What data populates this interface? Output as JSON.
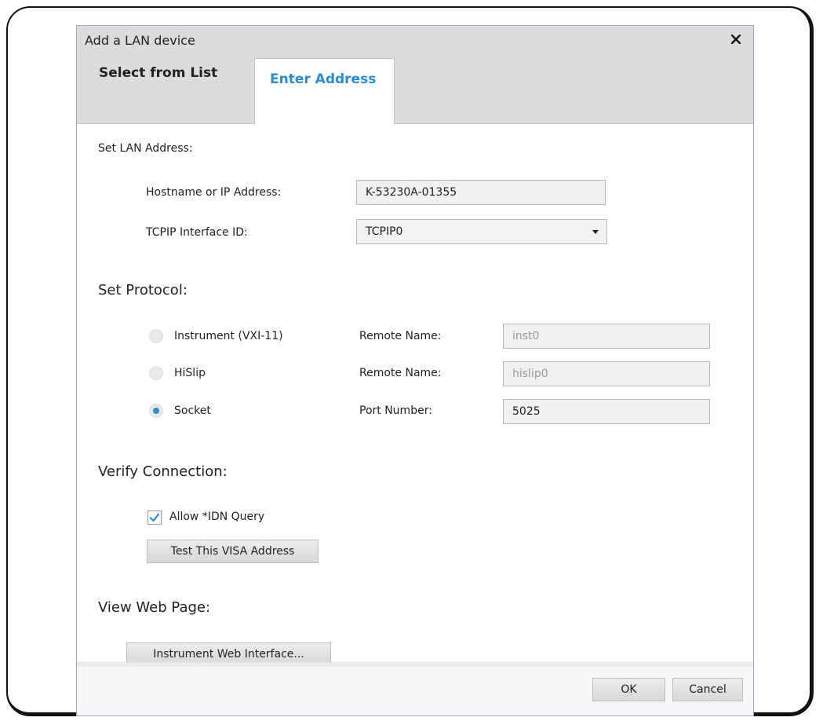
{
  "dialog": {
    "title": "Add a LAN device",
    "close_icon": "✕"
  },
  "tabs": [
    {
      "label": "Select from List",
      "active": false
    },
    {
      "label": "Enter Address",
      "active": true
    }
  ],
  "lan_address": {
    "heading": "Set LAN Address:",
    "hostname_label": "Hostname or IP Address:",
    "hostname_value": "K-53230A-01355",
    "interface_label": "TCPIP Interface ID:",
    "interface_value": "TCPIP0"
  },
  "protocol": {
    "heading": "Set Protocol:",
    "options": [
      {
        "label": "Instrument (VXI-11)",
        "field_label": "Remote Name:",
        "field_value": "inst0",
        "checked": false
      },
      {
        "label": "HiSlip",
        "field_label": "Remote Name:",
        "field_value": "hislip0",
        "checked": false
      },
      {
        "label": "Socket",
        "field_label": "Port Number:",
        "field_value": "5025",
        "checked": true
      }
    ]
  },
  "verify": {
    "heading": "Verify Connection:",
    "allow_idn_label": "Allow *IDN Query",
    "allow_idn_checked": true,
    "test_button": "Test This VISA Address"
  },
  "web": {
    "heading": "View Web Page:",
    "button": "Instrument Web Interface..."
  },
  "footer": {
    "ok": "OK",
    "cancel": "Cancel"
  },
  "colors": {
    "accent": "#2e8bd0",
    "titlebar": "#dcdcdc"
  }
}
